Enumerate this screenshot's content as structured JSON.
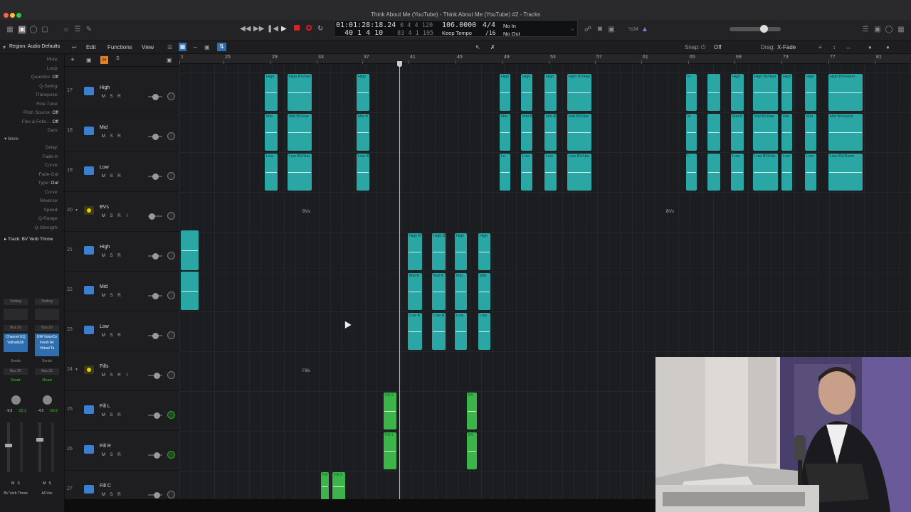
{
  "window": {
    "title": "Think About Me (YouTube) - Think About Me (YouTube) #2 - Tracks"
  },
  "transport": {
    "time": "01:01:28:18.24",
    "bars": "40  1  4  10",
    "sub1": "0  4  4  120",
    "sub2": "83  4  1  105",
    "tempo": "106.0000",
    "tempo_mode": "Keep Tempo",
    "signature": "4/4",
    "division": "/16",
    "in": "No In",
    "out": "No Out"
  },
  "control_right": {
    "label": "½34"
  },
  "menu": {
    "edit": "Edit",
    "functions": "Functions",
    "view": "View",
    "snap_label": "Snap:",
    "snap_value": "Off",
    "drag_label": "Drag:",
    "drag_value": "X-Fade"
  },
  "inspector": {
    "region_label": "Region:",
    "region_value": "Audio Defaults",
    "rows": [
      {
        "label": "Mute:",
        "value": ""
      },
      {
        "label": "Loop:",
        "value": ""
      },
      {
        "label": "Quantize:",
        "value": "Off"
      },
      {
        "label": "Q-Swing:",
        "value": ""
      },
      {
        "label": "Transpose:",
        "value": ""
      },
      {
        "label": "Fine Tune:",
        "value": ""
      },
      {
        "label": "Pitch Source:",
        "value": "Off"
      },
      {
        "label": "Flex & Follo…",
        "value": "Off"
      },
      {
        "label": "Gain:",
        "value": ""
      }
    ],
    "more": "More",
    "more_rows": [
      {
        "label": "Delay:",
        "value": ""
      },
      {
        "label": "Fade-In",
        "value": ""
      },
      {
        "label": "Curve:",
        "value": ""
      },
      {
        "label": "Fade-Out",
        "value": ""
      },
      {
        "label": "Type:",
        "value": "Out"
      },
      {
        "label": "Curve:",
        "value": ""
      },
      {
        "label": "Reverse:",
        "value": ""
      },
      {
        "label": "Speed:",
        "value": ""
      },
      {
        "label": "Q-Range:",
        "value": ""
      },
      {
        "label": "Q-Strength:",
        "value": ""
      }
    ],
    "track_label": "Track:",
    "track_value": "BV Verb Throw",
    "strips": [
      {
        "setting": "Setting",
        "eq": "",
        "input": "Bus 20",
        "plugin": "Channel EQ\nValhallaSh",
        "sends": "Sends",
        "output": "Bus 20",
        "read": "Read",
        "pan": "-9.8",
        "peak": "-22.1",
        "name": "BV Verb Throw"
      },
      {
        "setting": "Setting",
        "eq": "",
        "input": "Bus 20",
        "plugin": "GW VoiceCe\nFresh Air\nVirtual Ta",
        "sends": "Sends",
        "output": "Bus 30",
        "read": "Read",
        "pan": "-4.5",
        "peak": "-20.9",
        "name": "All Vox"
      }
    ]
  },
  "tracks": [
    {
      "num": "17",
      "name": "High",
      "kind": "audio"
    },
    {
      "num": "18",
      "name": "Mid",
      "kind": "audio"
    },
    {
      "num": "19",
      "name": "Low",
      "kind": "audio"
    },
    {
      "num": "20",
      "name": "BVs",
      "kind": "folder"
    },
    {
      "num": "21",
      "name": "High",
      "kind": "audio"
    },
    {
      "num": "22",
      "name": "Mid",
      "kind": "audio"
    },
    {
      "num": "23",
      "name": "Low",
      "kind": "audio"
    },
    {
      "num": "24",
      "name": "Fills",
      "kind": "folder"
    },
    {
      "num": "25",
      "name": "Fill L",
      "kind": "audio"
    },
    {
      "num": "26",
      "name": "Fill R",
      "kind": "audio"
    },
    {
      "num": "27",
      "name": "Fill C",
      "kind": "audio"
    }
  ],
  "track_buttons": {
    "m": "M",
    "s": "S",
    "r": "R",
    "i": "I"
  },
  "ruler": [
    "1",
    "25",
    "29",
    "33",
    "37",
    "41",
    "45",
    "49",
    "53",
    "57",
    "61",
    "65",
    "69",
    "73",
    "77",
    "81"
  ],
  "folder_labels": {
    "bvs_a": "BVs",
    "bvs_b": "BVs",
    "fills": "Fills"
  },
  "regions": [
    {
      "lane": 0,
      "label": "High",
      "color": "teal"
    },
    {
      "lane": 0,
      "label": "High BV/Har",
      "color": "teal"
    },
    {
      "lane": 0,
      "label": "High",
      "color": "teal"
    },
    {
      "lane": 0,
      "label": "High",
      "color": "teal"
    },
    {
      "lane": 0,
      "label": "High",
      "color": "teal"
    },
    {
      "lane": 0,
      "label": "High",
      "color": "teal"
    },
    {
      "lane": 0,
      "label": "High BV/Har",
      "color": "teal"
    },
    {
      "lane": 0,
      "label": "H",
      "color": "teal"
    },
    {
      "lane": 0,
      "label": "",
      "color": "teal"
    },
    {
      "lane": 0,
      "label": "High",
      "color": "teal"
    },
    {
      "lane": 0,
      "label": "High BV/Har",
      "color": "teal"
    },
    {
      "lane": 0,
      "label": "High",
      "color": "teal"
    },
    {
      "lane": 0,
      "label": "High",
      "color": "teal"
    },
    {
      "lane": 0,
      "label": "High BV/Harm",
      "color": "teal"
    },
    {
      "lane": 1,
      "label": "Mid",
      "color": "teal"
    },
    {
      "lane": 1,
      "label": "Mid BV/Har",
      "color": "teal"
    },
    {
      "lane": 1,
      "label": "Mid B",
      "color": "teal"
    },
    {
      "lane": 1,
      "label": "Mid",
      "color": "teal"
    },
    {
      "lane": 1,
      "label": "Mid B",
      "color": "teal"
    },
    {
      "lane": 1,
      "label": "Mid B",
      "color": "teal"
    },
    {
      "lane": 1,
      "label": "Mid BV/Har",
      "color": "teal"
    },
    {
      "lane": 1,
      "label": "M",
      "color": "teal"
    },
    {
      "lane": 1,
      "label": "",
      "color": "teal"
    },
    {
      "lane": 1,
      "label": "Mid B",
      "color": "teal"
    },
    {
      "lane": 1,
      "label": "Mid BV/Har",
      "color": "teal"
    },
    {
      "lane": 1,
      "label": "Mid",
      "color": "teal"
    },
    {
      "lane": 1,
      "label": "Mid",
      "color": "teal"
    },
    {
      "lane": 1,
      "label": "Mid BV/Harm",
      "color": "teal"
    },
    {
      "lane": 2,
      "label": "Low",
      "color": "teal"
    },
    {
      "lane": 2,
      "label": "Low BV/Har",
      "color": "teal"
    },
    {
      "lane": 2,
      "label": "Low B",
      "color": "teal"
    },
    {
      "lane": 2,
      "label": "Lo",
      "color": "teal"
    },
    {
      "lane": 2,
      "label": "Low",
      "color": "teal"
    },
    {
      "lane": 2,
      "label": "Low",
      "color": "teal"
    },
    {
      "lane": 2,
      "label": "Low BV/Har",
      "color": "teal"
    },
    {
      "lane": 2,
      "label": "L",
      "color": "teal"
    },
    {
      "lane": 2,
      "label": "",
      "color": "teal"
    },
    {
      "lane": 2,
      "label": "Low",
      "color": "teal"
    },
    {
      "lane": 2,
      "label": "Low BV/Har",
      "color": "teal"
    },
    {
      "lane": 2,
      "label": "Low",
      "color": "teal"
    },
    {
      "lane": 2,
      "label": "Low",
      "color": "teal"
    },
    {
      "lane": 2,
      "label": "Low BV/Harm",
      "color": "teal"
    },
    {
      "lane": 4,
      "label": "",
      "color": "teal"
    },
    {
      "lane": 4,
      "label": "High B",
      "color": "teal"
    },
    {
      "lane": 4,
      "label": "High B",
      "color": "teal"
    },
    {
      "lane": 4,
      "label": "High",
      "color": "teal"
    },
    {
      "lane": 4,
      "label": "High",
      "color": "teal"
    },
    {
      "lane": 5,
      "label": "",
      "color": "teal"
    },
    {
      "lane": 5,
      "label": "Mid B",
      "color": "teal"
    },
    {
      "lane": 5,
      "label": "Mid B",
      "color": "teal"
    },
    {
      "lane": 5,
      "label": "Mid",
      "color": "teal"
    },
    {
      "lane": 5,
      "label": "Mid",
      "color": "teal"
    },
    {
      "lane": 6,
      "label": "Low B",
      "color": "teal"
    },
    {
      "lane": 6,
      "label": "Low B",
      "color": "teal"
    },
    {
      "lane": 6,
      "label": "Low",
      "color": "teal"
    },
    {
      "lane": 6,
      "label": "Low",
      "color": "teal"
    },
    {
      "lane": 8,
      "label": "Fill S",
      "color": "green"
    },
    {
      "lane": 8,
      "label": "BV",
      "color": "green"
    },
    {
      "lane": 9,
      "label": "Fill 1",
      "color": "green"
    },
    {
      "lane": 9,
      "label": "BV",
      "color": "green"
    },
    {
      "lane": 10,
      "label": "Fill",
      "color": "green"
    },
    {
      "lane": 10,
      "label": "Fill S",
      "color": "green"
    }
  ]
}
